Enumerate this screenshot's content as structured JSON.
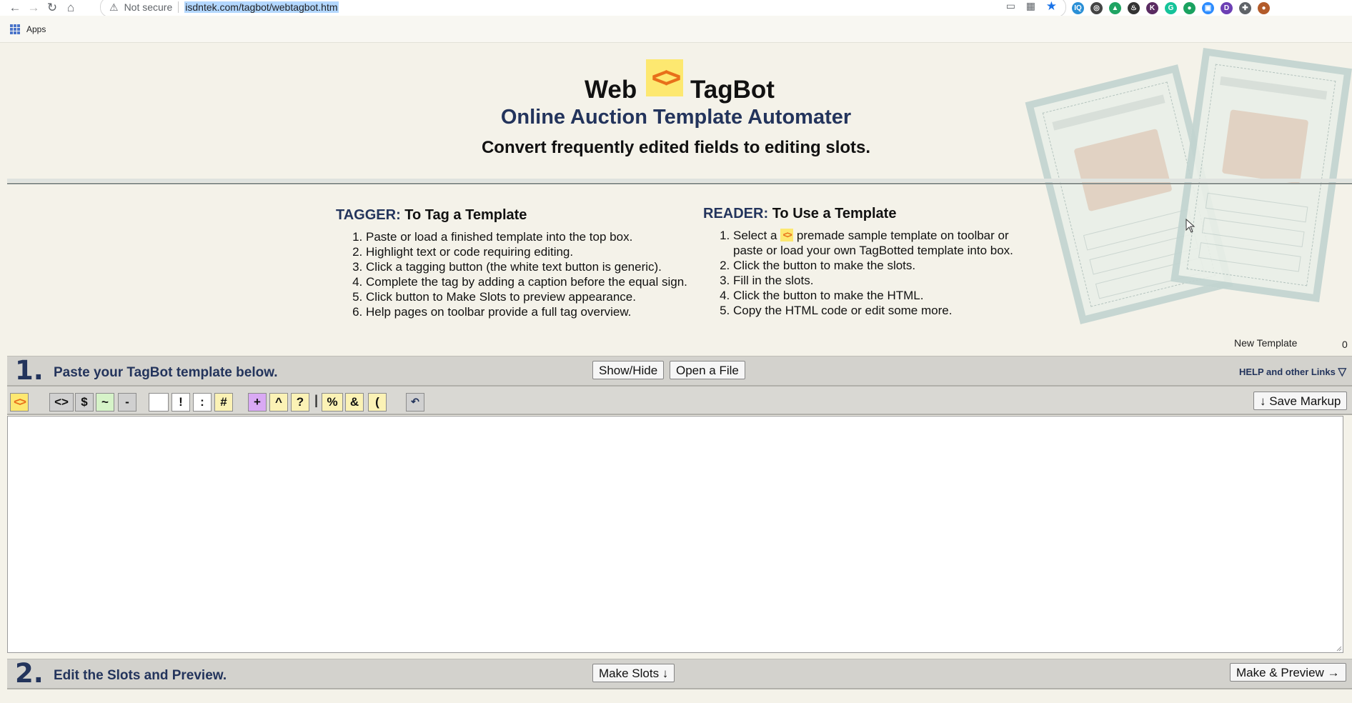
{
  "browser": {
    "security_label": "Not secure",
    "url": "isdntek.com/tagbot/webtagbot.htm",
    "bookmarks_apps_label": "Apps",
    "extensions": [
      {
        "name": "iq-extension-icon",
        "label": "IQ",
        "color": "#2a8fd6"
      },
      {
        "name": "camera-extension-icon",
        "label": "◎",
        "color": "#444444"
      },
      {
        "name": "drive-extension-icon",
        "label": "▲",
        "color": "#1fa463"
      },
      {
        "name": "flame-extension-icon",
        "label": "♨",
        "color": "#333333"
      },
      {
        "name": "k-extension-icon",
        "label": "K",
        "color": "#5a2b62"
      },
      {
        "name": "grammarly-extension-icon",
        "label": "G",
        "color": "#15c39a"
      },
      {
        "name": "chat-extension-icon",
        "label": "●",
        "color": "#1aa260"
      },
      {
        "name": "zoom-extension-icon",
        "label": "▣",
        "color": "#2d8cff"
      },
      {
        "name": "d-extension-icon",
        "label": "D",
        "color": "#6c3fb4"
      },
      {
        "name": "puzzle-extension-icon",
        "label": "✚",
        "color": "#5f6368"
      },
      {
        "name": "profile-avatar-icon",
        "label": "●",
        "color": "#b35b2a"
      }
    ]
  },
  "header": {
    "title_left": "Web",
    "title_right": "TagBot",
    "logo_glyph": "<>",
    "subtitle": "Online Auction Template Automater",
    "tagline": "Convert frequently edited fields to editing slots."
  },
  "tagger": {
    "role": "TAGGER:",
    "heading": "To Tag a Template",
    "steps": [
      "Paste or load a finished template into the top box.",
      "Highlight text or code requiring editing.",
      "Click a tagging button (the white text button is generic).",
      "Complete the tag by adding a caption before the equal sign.",
      "Click button to Make Slots to preview appearance.",
      "Help pages on toolbar provide a full tag overview."
    ]
  },
  "reader": {
    "role": "READER:",
    "heading": "To Use a Template",
    "step1_before": "Select a",
    "step1_after": "premade sample template on toolbar or",
    "step1_line2": "paste or load your own TagBotted template into box.",
    "steps": [
      "Click the button to make the slots.",
      "Fill in the slots.",
      "Click the button to make the HTML.",
      "Copy the HTML code or edit some more."
    ]
  },
  "new_template": {
    "label": "New Template",
    "count": "0"
  },
  "step1": {
    "number": "1.",
    "text": "Paste your TagBot template below.",
    "show_hide_label": "Show/Hide",
    "open_file_label": "Open a File",
    "help_links_label": "HELP and other Links"
  },
  "toolbar": {
    "buttons": [
      {
        "name": "tagbot-logo-button",
        "label": "<>"
      },
      {
        "name": "angle-tag-button",
        "label": "<>"
      },
      {
        "name": "dollar-tag-button",
        "label": "$"
      },
      {
        "name": "tilde-tag-button",
        "label": "~"
      },
      {
        "name": "minus-tag-button",
        "label": "-"
      },
      {
        "name": "generic-text-tag-button",
        "label": ""
      },
      {
        "name": "exclaim-tag-button",
        "label": "!"
      },
      {
        "name": "colon-tag-button",
        "label": ":"
      },
      {
        "name": "hash-tag-button",
        "label": "#"
      },
      {
        "name": "plus-tag-button",
        "label": "+"
      },
      {
        "name": "caret-tag-button",
        "label": "^"
      },
      {
        "name": "question-tag-button",
        "label": "?"
      },
      {
        "name": "percent-tag-button",
        "label": "%"
      },
      {
        "name": "ampersand-tag-button",
        "label": "&"
      },
      {
        "name": "paren-tag-button",
        "label": "("
      },
      {
        "name": "undo-button",
        "label": "↶"
      }
    ],
    "separator": "|",
    "save_markup_label": "↓ Save Markup"
  },
  "template_box": {
    "value": ""
  },
  "step2": {
    "number": "2.",
    "text": "Edit the Slots and Preview.",
    "make_slots_label": "Make Slots ↓",
    "make_preview_label": "Make & Preview →"
  },
  "colors": {
    "navy": "#23345c",
    "logo_yellow": "#fde870",
    "logo_orange": "#e8701a",
    "page_bg": "#f4f2e9"
  }
}
